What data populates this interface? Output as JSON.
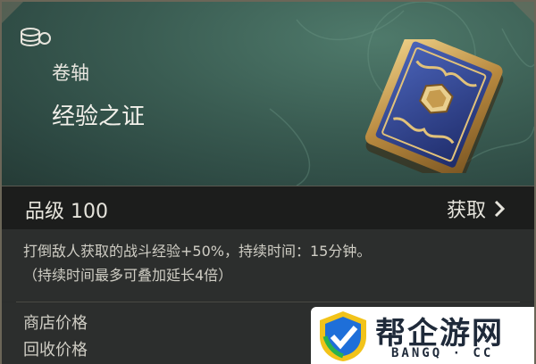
{
  "item": {
    "type": "卷轴",
    "name": "经验之证",
    "icon": "coin-stack-icon",
    "image": "card-scroll-icon"
  },
  "grade": {
    "label": "品级 100",
    "acquire_label": "获取"
  },
  "description": {
    "line1": "打倒敌人获取的战斗经验+50%，持续时间：15分钟。",
    "line2": "（持续时间最多可叠加延长4倍）"
  },
  "prices": {
    "shop": "商店价格",
    "recycle": "回收价格"
  },
  "watermark": {
    "title": "帮企游网",
    "subtitle": "BANGQ · CC"
  },
  "colors": {
    "panel_top": "#3a5c52",
    "panel_bottom": "#2c2e2d",
    "card_blue": "#2c3f8a",
    "card_gold": "#c9a35a"
  }
}
